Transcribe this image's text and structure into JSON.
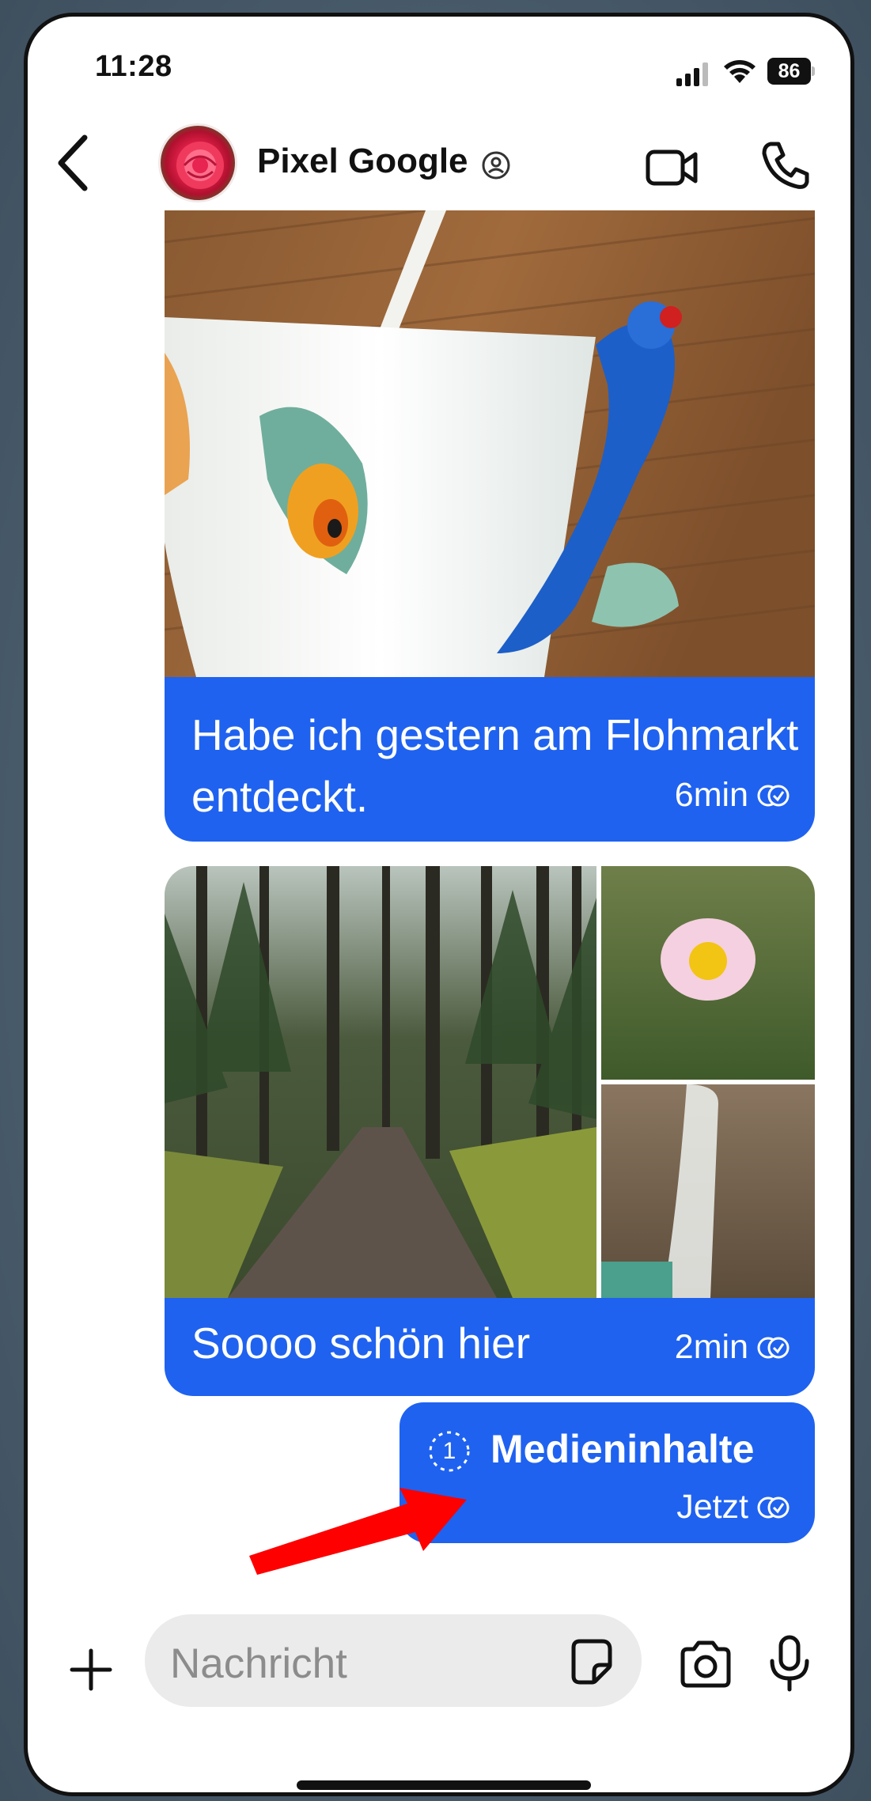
{
  "status_bar": {
    "time": "11:28",
    "battery": "86"
  },
  "header": {
    "contact_name": "Pixel Google"
  },
  "messages": [
    {
      "text": "Habe ich gestern am Flohmarkt entdeckt.",
      "time": "6min"
    },
    {
      "text": "Soooo schön hier",
      "time": "2min"
    },
    {
      "once_count": "1",
      "label": "Medieninhalte",
      "time": "Jetzt"
    }
  ],
  "composer": {
    "placeholder": "Nachricht"
  },
  "colors": {
    "bubble": "#1f62f0",
    "arrow": "#ff0000"
  }
}
